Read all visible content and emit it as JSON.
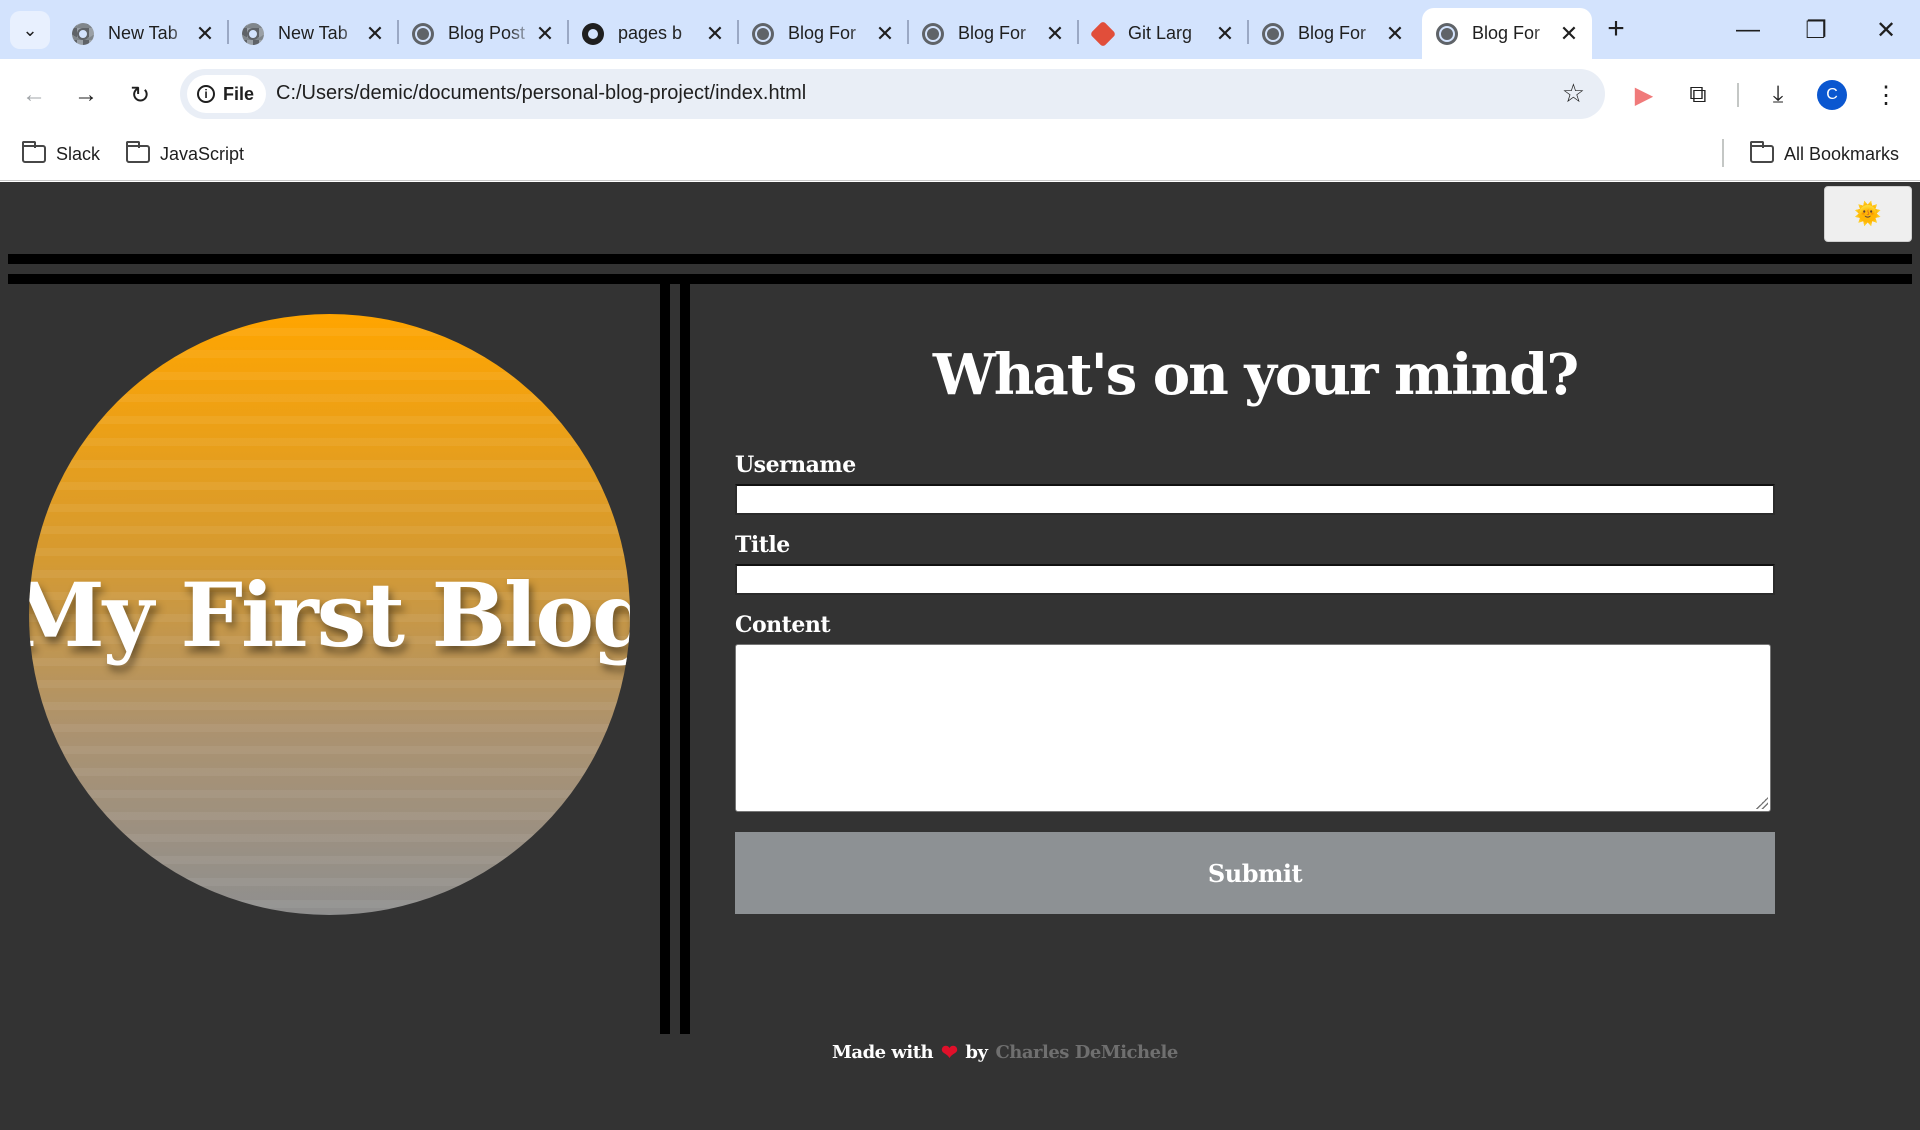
{
  "browser": {
    "tabs": [
      {
        "label": "New Tab",
        "icon": "chrome-icon"
      },
      {
        "label": "New Tab",
        "icon": "chrome-icon"
      },
      {
        "label": "Blog Post",
        "icon": "globe-icon"
      },
      {
        "label": "pages b",
        "icon": "github-icon"
      },
      {
        "label": "Blog For",
        "icon": "globe-icon"
      },
      {
        "label": "Blog For",
        "icon": "globe-icon"
      },
      {
        "label": "Git Larg",
        "icon": "git-lfs-icon"
      },
      {
        "label": "Blog For",
        "icon": "globe-icon"
      },
      {
        "label": "Blog For",
        "icon": "globe-icon",
        "active": true
      }
    ],
    "address": {
      "chip_label": "File",
      "url": "C:/Users/demic/documents/personal-blog-project/index.html"
    },
    "profile_initial": "C",
    "bookmarks": [
      {
        "label": "Slack"
      },
      {
        "label": "JavaScript"
      }
    ],
    "all_bookmarks_label": "All Bookmarks"
  },
  "page": {
    "theme_toggle_icon": "🌞",
    "blog_title": "My First Blog",
    "form": {
      "heading": "What's on your mind?",
      "username_label": "Username",
      "username_value": "",
      "title_label": "Title",
      "title_value": "",
      "content_label": "Content",
      "content_value": "",
      "submit_label": "Submit"
    },
    "footer": {
      "made_with": "Made with",
      "heart": "❤",
      "by": "by",
      "author": "Charles DeMichele"
    }
  },
  "colors": {
    "page_background": "#333333",
    "sun_top": "#ffa500",
    "sun_bottom": "#8f8f8f",
    "submit_background": "#8d9194",
    "author_link": "#6f6f6f",
    "tab_strip": "#d3e3fd"
  }
}
